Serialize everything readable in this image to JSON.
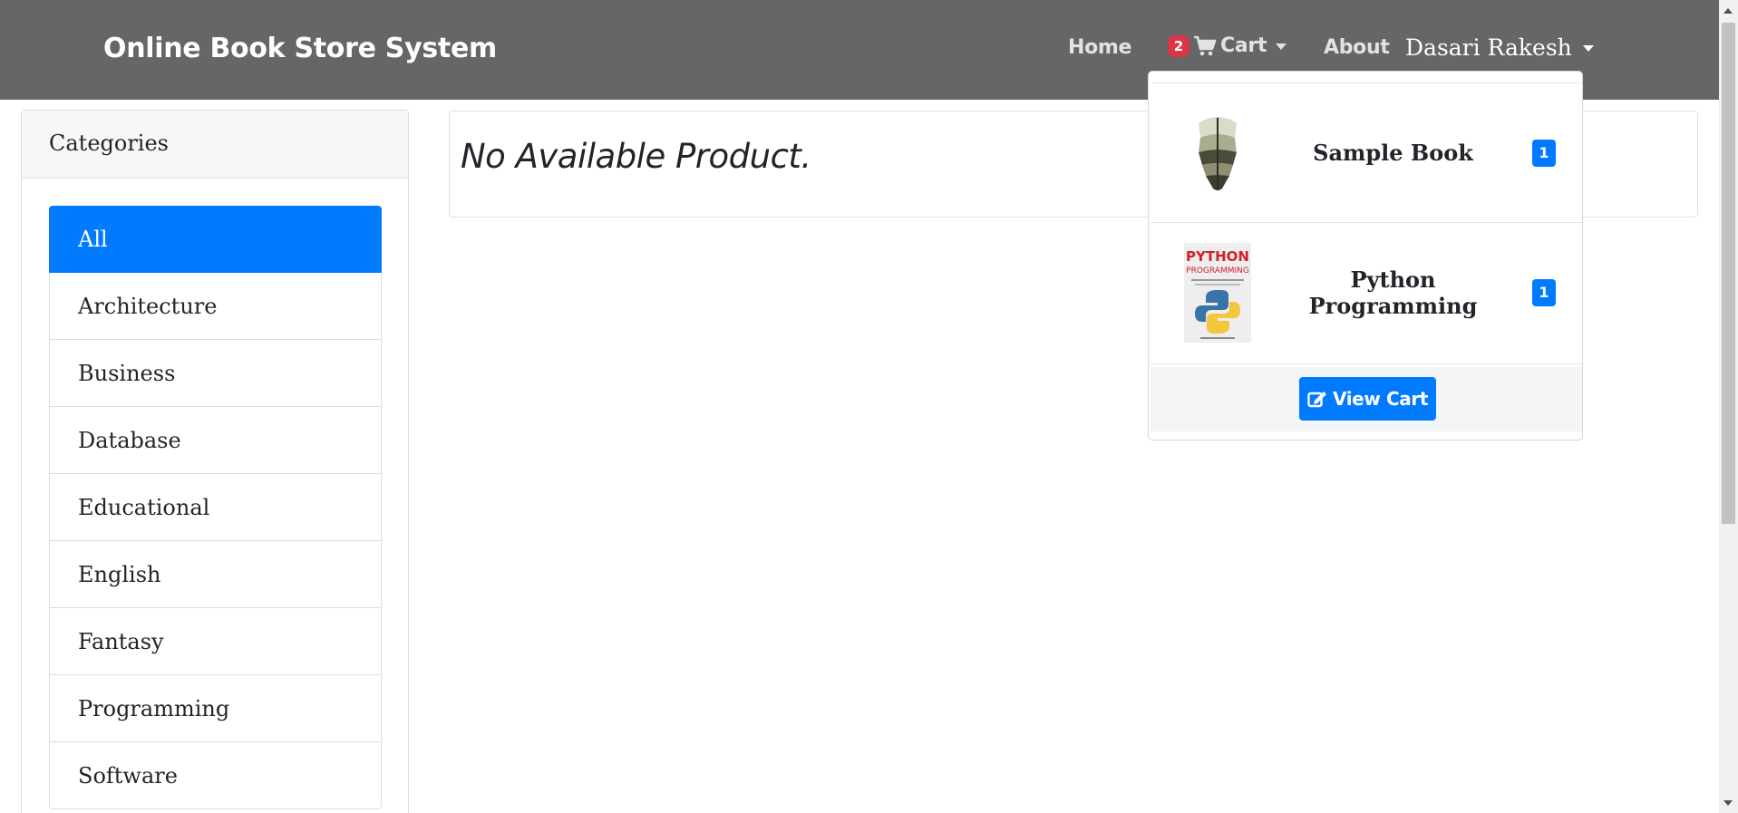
{
  "navbar": {
    "brand": "Online Book Store System",
    "home": "Home",
    "cart_count": "2",
    "cart_label": "Cart",
    "about": "About",
    "user": "Dasari Rakesh",
    "colors": {
      "background": "#666568",
      "badge": "#dc3545"
    }
  },
  "sidebar": {
    "title": "Categories",
    "items": [
      {
        "label": "All",
        "active": true
      },
      {
        "label": "Architecture"
      },
      {
        "label": "Business"
      },
      {
        "label": "Database"
      },
      {
        "label": "Educational"
      },
      {
        "label": "English"
      },
      {
        "label": "Fantasy"
      },
      {
        "label": "Programming"
      },
      {
        "label": "Software"
      }
    ],
    "accent": "#007bff"
  },
  "main": {
    "message": "No Available Product."
  },
  "cart_dropdown": {
    "items": [
      {
        "title": "Sample Book",
        "qty": "1",
        "thumbnail": "open-book-image"
      },
      {
        "title": "Python Programming",
        "qty": "1",
        "thumbnail": "python-book-cover",
        "cover_text": [
          "PYTHON",
          "PROGRAMMING"
        ]
      }
    ],
    "view_cart_label": "View Cart",
    "icons": {
      "cart": "shopping-cart-icon",
      "view_cart": "edit-icon"
    }
  }
}
